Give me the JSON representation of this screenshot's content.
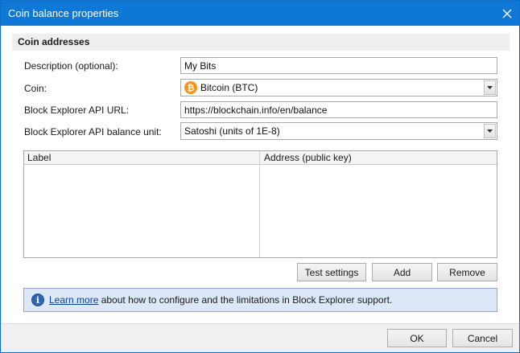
{
  "window": {
    "title": "Coin balance properties"
  },
  "group": {
    "title": "Coin addresses"
  },
  "form": {
    "description_label": "Description (optional):",
    "description_value": "My Bits",
    "coin_label": "Coin:",
    "coin_value": "Bitcoin (BTC)",
    "coin_icon": "bitcoin-icon",
    "api_url_label": "Block Explorer API URL:",
    "api_url_value": "https://blockchain.info/en/balance",
    "unit_label": "Block Explorer API balance unit:",
    "unit_value": "Satoshi (units of 1E-8)"
  },
  "grid": {
    "columns": [
      "Label",
      "Address (public key)"
    ],
    "rows": []
  },
  "actions": {
    "test_label": "Test settings",
    "add_label": "Add",
    "remove_label": "Remove"
  },
  "info": {
    "link_text": "Learn more",
    "text": " about how to configure and the limitations in Block Explorer support."
  },
  "footer": {
    "ok_label": "OK",
    "cancel_label": "Cancel"
  },
  "colors": {
    "titlebar": "#0f78d7",
    "info_background": "#dce8f7",
    "bitcoin": "#f7931a"
  }
}
